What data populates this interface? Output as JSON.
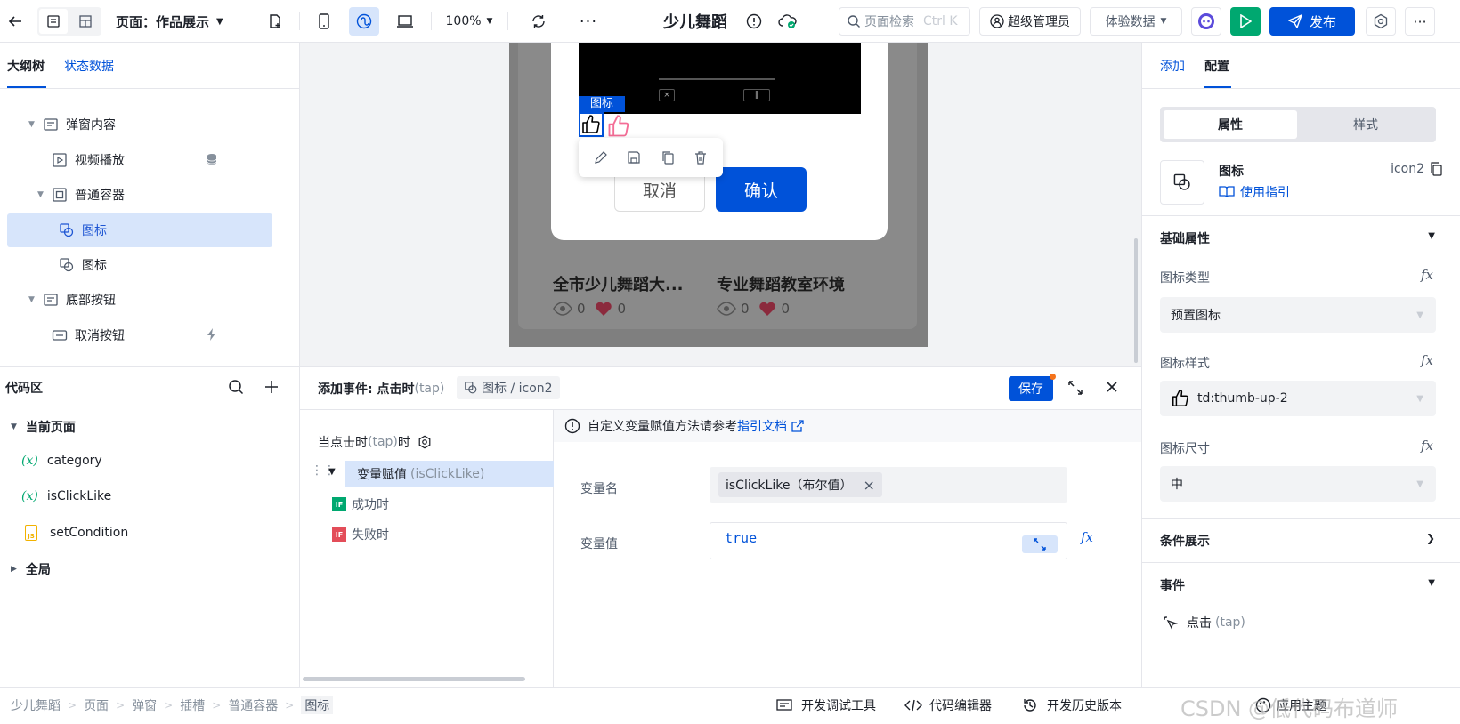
{
  "topbar": {
    "page_label": "页面：作品展示",
    "zoom": "100%",
    "app_title": "少儿舞蹈",
    "search_placeholder": "页面检索",
    "search_shortcut": "Ctrl K",
    "user_role": "超级管理员",
    "data_mode": "体验数据",
    "publish_label": "发布"
  },
  "left": {
    "tabs": [
      "大纲树",
      "状态数据"
    ],
    "tree": [
      {
        "label": "弹窗内容"
      },
      {
        "label": "视频播放"
      },
      {
        "label": "普通容器"
      },
      {
        "label": "图标"
      },
      {
        "label": "图标"
      },
      {
        "label": "底部按钮"
      },
      {
        "label": "取消按钮"
      }
    ],
    "code_title": "代码区",
    "code_groups": {
      "current": "当前页面",
      "global": "全局"
    },
    "code_items": [
      "category",
      "isClickLike",
      "setCondition"
    ],
    "var_badge": "(x)",
    "js_badge": "JS"
  },
  "canvas": {
    "icon_tag": "图标",
    "cancel_label": "取消",
    "confirm_label": "确认",
    "card1_title": "全市少儿舞蹈大...",
    "card2_title": "专业舞蹈教室环境",
    "views": "0",
    "likes": "0"
  },
  "event": {
    "title": "添加事件: 点击时",
    "title_tap": "(tap)",
    "target": "图标 / icon2",
    "save_label": "保存",
    "trigger_prefix": "当点击时",
    "trigger_tap": "(tap)",
    "trigger_suffix": "时",
    "action_label": "变量赋值",
    "action_var": "(isClickLike)",
    "if_badge": "IF",
    "success_label": "成功时",
    "fail_label": "失败时",
    "info_text": "自定义变量赋值方法请参考",
    "info_link": "指引文档",
    "var_name_label": "变量名",
    "var_name_value": "isClickLike（布尔值）",
    "var_value_label": "变量值",
    "var_value": "true",
    "fx": "fx"
  },
  "right": {
    "tabs": [
      "添加",
      "配置"
    ],
    "subtabs": [
      "属性",
      "样式"
    ],
    "component_name": "图标",
    "component_id": "icon2",
    "guide_link": "使用指引",
    "basic_title": "基础属性",
    "icon_type_label": "图标类型",
    "icon_type_value": "预置图标",
    "icon_style_label": "图标样式",
    "icon_style_value": "td:thumb-up-2",
    "icon_size_label": "图标尺寸",
    "icon_size_value": "中",
    "cond_title": "条件展示",
    "events_title": "事件",
    "event_item": "点击",
    "event_item_tap": "(tap)",
    "fx": "fx"
  },
  "status": {
    "breadcrumb": [
      "少儿舞蹈",
      "页面",
      "弹窗",
      "插槽",
      "普通容器",
      "图标"
    ],
    "debug_tool": "开发调试工具",
    "code_editor": "代码编辑器",
    "history": "开发历史版本",
    "apply_theme": "应用主题",
    "watermark": "CSDN @低代码布道师"
  },
  "colors": {
    "primary": "#0052d9",
    "green": "#00a870",
    "selected_bg": "#d7e5fb",
    "pink": "#f46d96"
  }
}
